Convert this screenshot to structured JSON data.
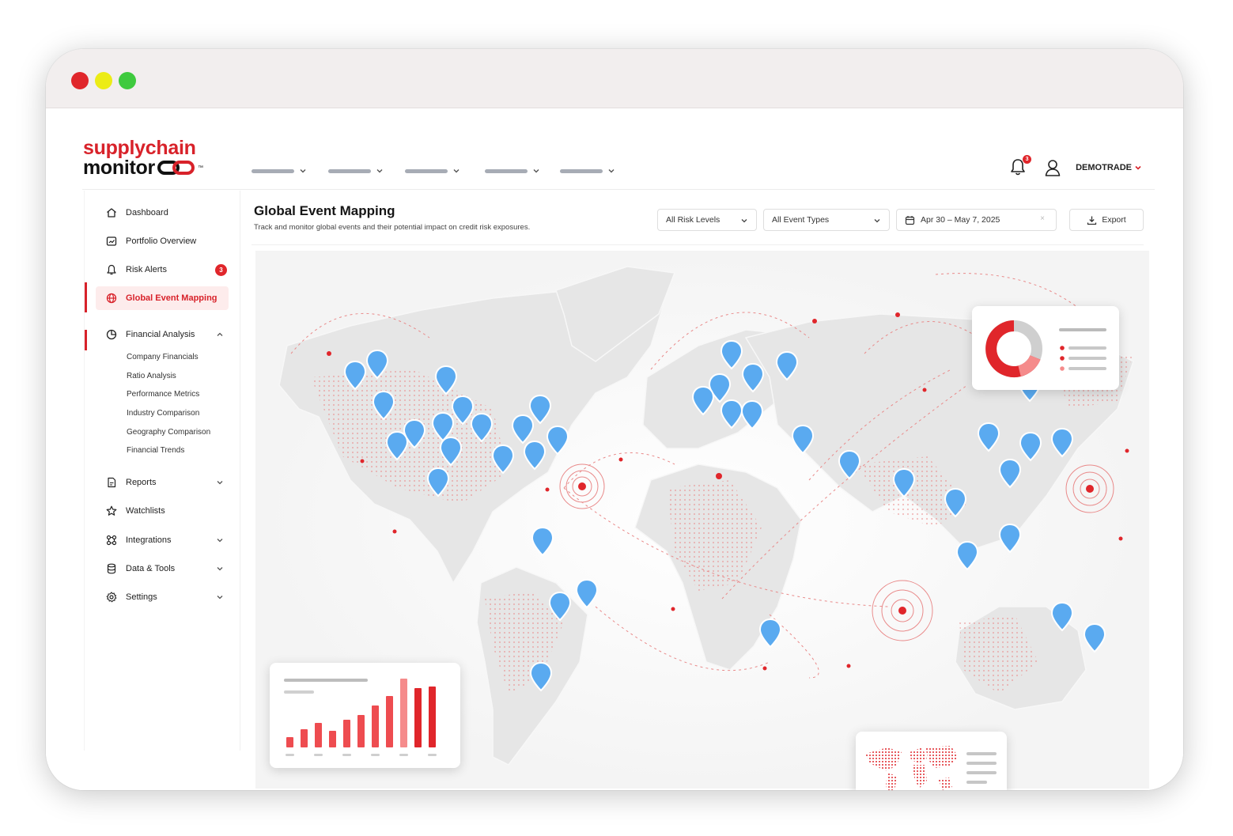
{
  "brand": {
    "logo_top": "supplychain",
    "logo_bottom": "monitor",
    "trademark": "™",
    "accent": "#d8222a"
  },
  "header": {
    "notification_count": "3",
    "user_name": "DEMOTRADE",
    "icons": [
      "bell-icon",
      "user-icon",
      "chevron-down-icon"
    ]
  },
  "sidebar": {
    "items": [
      {
        "label": "Dashboard",
        "icon": "home-icon"
      },
      {
        "label": "Portfolio Overview",
        "icon": "portfolio-icon"
      },
      {
        "label": "Risk Alerts",
        "icon": "bell-icon",
        "badge": "3"
      },
      {
        "label": "Global Event Mapping",
        "icon": "globe-icon",
        "active": true
      },
      {
        "label": "Financial Analysis",
        "icon": "pie-chart-icon",
        "expanded": true
      },
      {
        "label": "Reports",
        "icon": "report-icon"
      },
      {
        "label": "Watchlists",
        "icon": "star-icon"
      },
      {
        "label": "Integrations",
        "icon": "integrations-icon"
      },
      {
        "label": "Data & Tools",
        "icon": "database-icon"
      },
      {
        "label": "Settings",
        "icon": "gear-icon"
      }
    ],
    "financial_sub": [
      "Company Financials",
      "Ratio Analysis",
      "Performance Metrics",
      "Industry Comparison",
      "Geography Comparison",
      "Financial Trends"
    ]
  },
  "main": {
    "title": "Global Event Mapping",
    "subtitle": "Track and monitor global events and their potential impact on credit risk exposures.",
    "filters": {
      "risk_levels": "All Risk Levels",
      "event_types": "All Event Types",
      "date_range": "Apr 30 – May 7, 2025",
      "clear": "×",
      "export": "Export"
    }
  },
  "colors": {
    "pin": "#5aaaf0",
    "alert": "#e0262b",
    "land": "#e8e8e8"
  }
}
